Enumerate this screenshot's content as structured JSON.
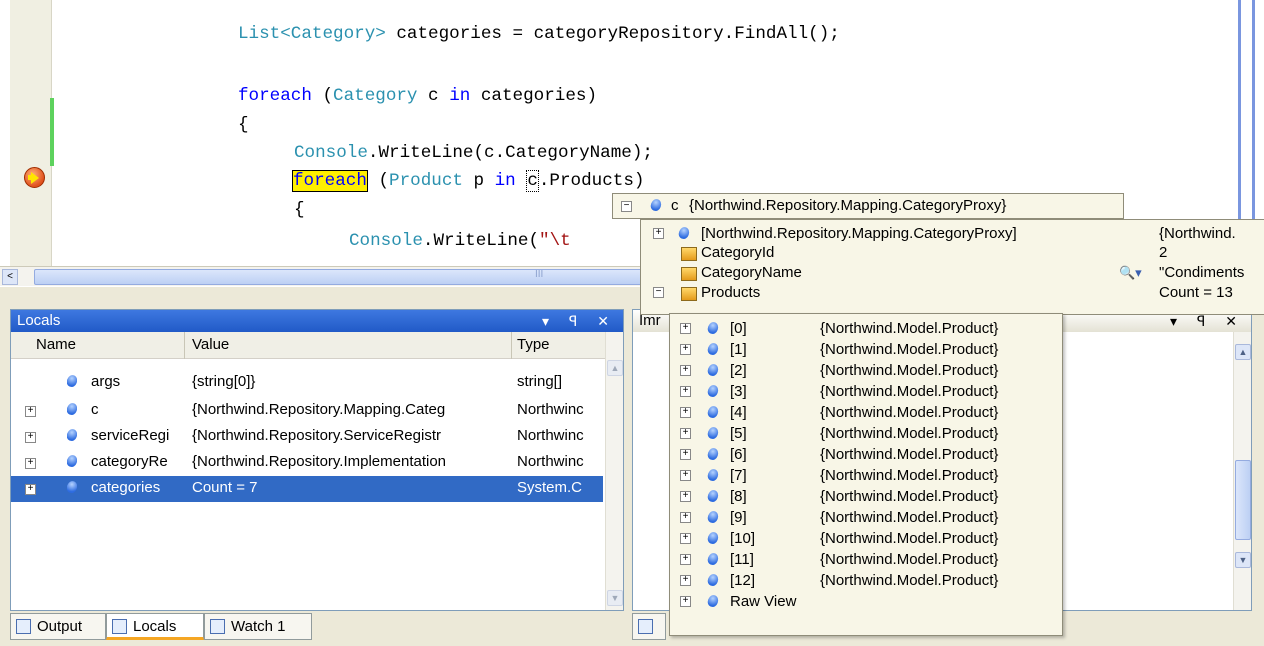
{
  "code": {
    "line1": {
      "type": "List<Category>",
      "rest": " categories = categoryRepository.FindAll();"
    },
    "line2": {
      "kw1": "foreach",
      "p1": " (",
      "type": "Category",
      "p2": " c ",
      "kw2": "in",
      "p3": " categories)"
    },
    "line3": "{",
    "line4": {
      "type": "Console",
      "rest": ".WriteLine(c.CategoryName);"
    },
    "line5": {
      "kw1": "foreach",
      "p1": " (",
      "type": "Product",
      "p2": " p ",
      "kw2": "in",
      "p3": " ",
      "caret": "c",
      "p4": ".Products)"
    },
    "line6": "{",
    "line7": {
      "type": "Console",
      "rest": ".WriteLine(",
      "str": "\"\\t"
    }
  },
  "hscroll": {
    "left": "<",
    "grip": "III"
  },
  "locals": {
    "title": "Locals",
    "title_buttons": "▾ ꟼ ✕",
    "columns": [
      "Name",
      "Value",
      "Type"
    ],
    "rows": [
      {
        "name": "args",
        "value": "{string[0]}",
        "type": "string[]"
      },
      {
        "name": "c",
        "value": "{Northwind.Repository.Mapping.Categ",
        "type": "Northwinc"
      },
      {
        "name": "serviceRegi",
        "value": "{Northwind.Repository.ServiceRegistr",
        "type": "Northwinc"
      },
      {
        "name": "categoryRe",
        "value": "{Northwind.Repository.Implementation",
        "type": "Northwinc"
      },
      {
        "name": "categories",
        "value": "Count = 7",
        "type": "System.C"
      }
    ]
  },
  "immediate": {
    "title": "Imr",
    "title_buttons": "▾ ꟼ ✕"
  },
  "tabs": [
    "Output",
    "Locals",
    "Watch 1"
  ],
  "datatip": {
    "head_name": "c",
    "head_value": "{Northwind.Repository.Mapping.CategoryProxy}",
    "main": [
      {
        "name": "[Northwind.Repository.Mapping.CategoryProxy]",
        "value": "{Northwind."
      },
      {
        "name": "CategoryId",
        "value": "2"
      },
      {
        "name": "CategoryName",
        "value": "\"Condiments"
      },
      {
        "name": "Products",
        "value": "Count = 13"
      }
    ],
    "products": [
      {
        "name": "[0]",
        "value": "{Northwind.Model.Product}"
      },
      {
        "name": "[1]",
        "value": "{Northwind.Model.Product}"
      },
      {
        "name": "[2]",
        "value": "{Northwind.Model.Product}"
      },
      {
        "name": "[3]",
        "value": "{Northwind.Model.Product}"
      },
      {
        "name": "[4]",
        "value": "{Northwind.Model.Product}"
      },
      {
        "name": "[5]",
        "value": "{Northwind.Model.Product}"
      },
      {
        "name": "[6]",
        "value": "{Northwind.Model.Product}"
      },
      {
        "name": "[7]",
        "value": "{Northwind.Model.Product}"
      },
      {
        "name": "[8]",
        "value": "{Northwind.Model.Product}"
      },
      {
        "name": "[9]",
        "value": "{Northwind.Model.Product}"
      },
      {
        "name": "[10]",
        "value": "{Northwind.Model.Product}"
      },
      {
        "name": "[11]",
        "value": "{Northwind.Model.Product}"
      },
      {
        "name": "[12]",
        "value": "{Northwind.Model.Product}"
      },
      {
        "name": "Raw View",
        "value": ""
      }
    ]
  },
  "colors": {
    "selection": "#316ac5",
    "keyword": "#0000ff",
    "type": "#2b91af",
    "current_statement": "#ffef00"
  }
}
